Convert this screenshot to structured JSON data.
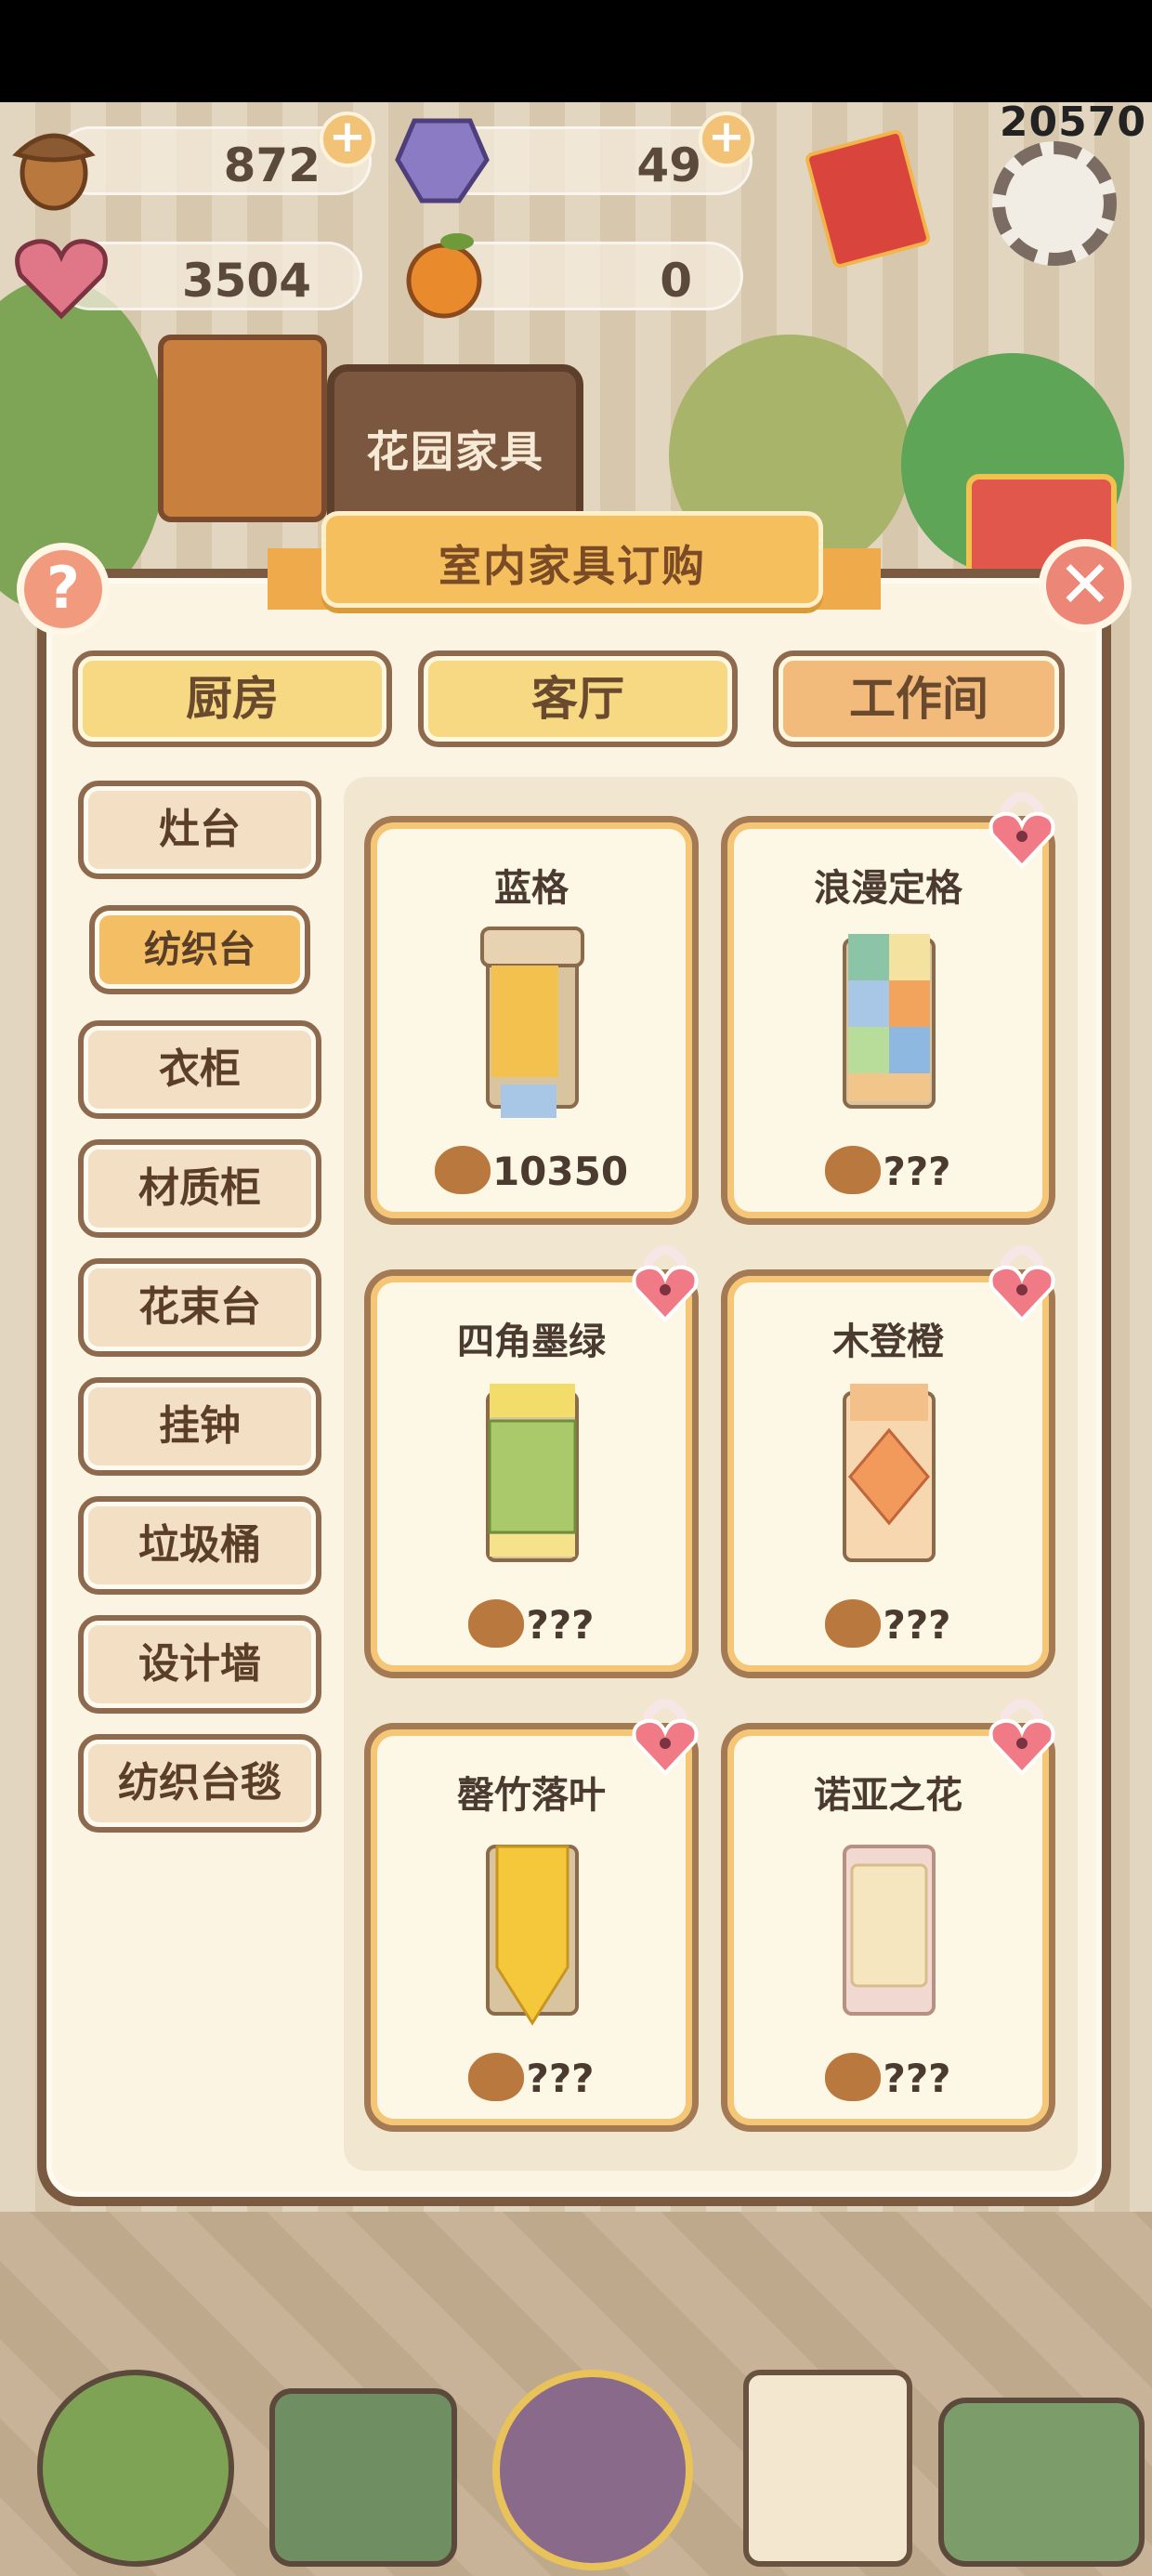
{
  "overlay": {
    "fps": "20570"
  },
  "resources": [
    {
      "name": "acorn",
      "icon": "acorn-icon",
      "value": "872",
      "plus": "+"
    },
    {
      "name": "gem",
      "icon": "purple-gem-icon",
      "value": "49",
      "plus": "+"
    },
    {
      "name": "heart",
      "icon": "heart-gem-icon",
      "value": "3504"
    },
    {
      "name": "orange",
      "icon": "orange-icon",
      "value": "0"
    }
  ],
  "scene": {
    "garden_sign": "花园家具"
  },
  "panel": {
    "title": "室内家具订购",
    "help": "?",
    "close": "✕",
    "tabs": [
      {
        "label": "厨房",
        "state": "default"
      },
      {
        "label": "客厅",
        "state": "default"
      },
      {
        "label": "工作间",
        "state": "selected"
      }
    ],
    "categories": [
      {
        "label": "灶台"
      },
      {
        "label": "纺织台",
        "active": true
      },
      {
        "label": "衣柜"
      },
      {
        "label": "材质柜"
      },
      {
        "label": "花束台"
      },
      {
        "label": "挂钟"
      },
      {
        "label": "垃圾桶"
      },
      {
        "label": "设计墙"
      },
      {
        "label": "纺织台毯"
      }
    ],
    "items": [
      {
        "name": "蓝格",
        "price": "10350",
        "locked": false,
        "color": "#f2c14e"
      },
      {
        "name": "浪漫定格",
        "price": "???",
        "locked": true,
        "color": "#8cc4a8"
      },
      {
        "name": "四角墨绿",
        "price": "???",
        "locked": true,
        "color": "#a9c96a"
      },
      {
        "name": "木登橙",
        "price": "???",
        "locked": true,
        "color": "#f4c08a"
      },
      {
        "name": "罄竹落叶",
        "price": "???",
        "locked": true,
        "color": "#f5c73a"
      },
      {
        "name": "诺亚之花",
        "price": "???",
        "locked": true,
        "color": "#f6e6c0"
      }
    ]
  },
  "colors": {
    "panel_border": "#7a5a41",
    "banner": "#f6bf5e",
    "lock": "#f07a86"
  }
}
